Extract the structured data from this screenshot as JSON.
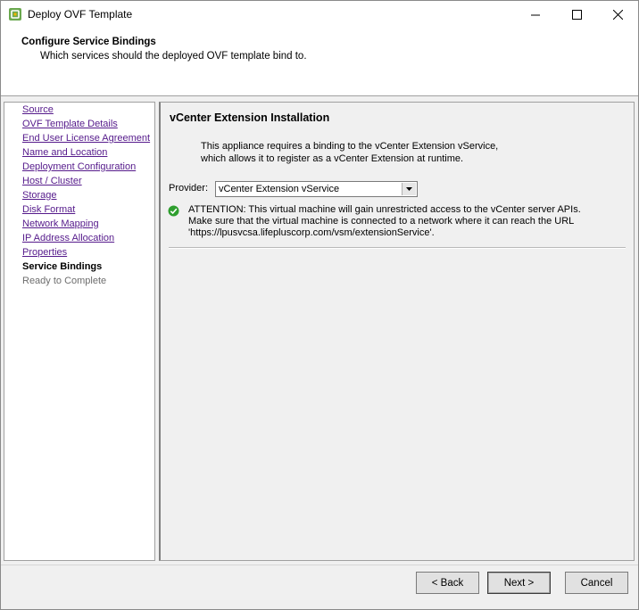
{
  "window": {
    "title": "Deploy OVF Template"
  },
  "header": {
    "title": "Configure Service Bindings",
    "subtitle": "Which services should the deployed OVF template bind to."
  },
  "nav": {
    "items": [
      {
        "label": "Source",
        "state": "link"
      },
      {
        "label": "OVF Template Details",
        "state": "link"
      },
      {
        "label": "End User License Agreement",
        "state": "link"
      },
      {
        "label": "Name and Location",
        "state": "link"
      },
      {
        "label": "Deployment Configuration",
        "state": "link"
      },
      {
        "label": "Host / Cluster",
        "state": "link"
      },
      {
        "label": "Storage",
        "state": "link"
      },
      {
        "label": "Disk Format",
        "state": "link"
      },
      {
        "label": "Network Mapping",
        "state": "link"
      },
      {
        "label": "IP Address Allocation",
        "state": "link"
      },
      {
        "label": "Properties",
        "state": "link"
      },
      {
        "label": "Service Bindings",
        "state": "current"
      },
      {
        "label": "Ready to Complete",
        "state": "disabled"
      }
    ]
  },
  "main": {
    "title": "vCenter Extension Installation",
    "description_line1": "This appliance requires a binding to the vCenter Extension vService,",
    "description_line2": "which allows it to register as a vCenter Extension at runtime.",
    "provider_label": "Provider:",
    "provider_value": "vCenter Extension vService",
    "attention_line1": "ATTENTION: This virtual machine will gain unrestricted access to the vCenter server APIs.",
    "attention_line2": "Make sure that the virtual machine is connected to a network where it can reach the URL",
    "attention_line3": "'https://lpusvcsa.lifepluscorp.com/vsm/extensionService'."
  },
  "buttons": {
    "back": "< Back",
    "next": "Next >",
    "cancel": "Cancel"
  },
  "colors": {
    "link": "#551a8b",
    "check_green": "#2e9e2e"
  }
}
